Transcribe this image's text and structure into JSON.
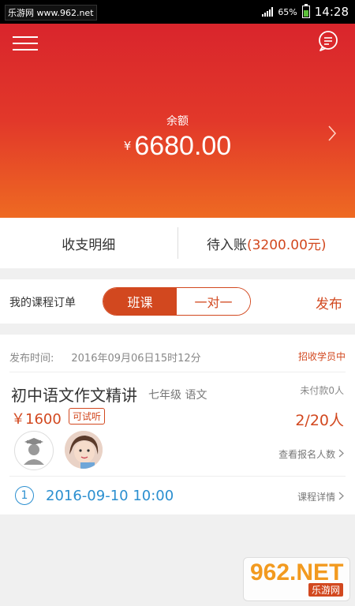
{
  "status_bar": {
    "watermark": "乐游网 www.962.net",
    "battery": "65%",
    "time": "14:28"
  },
  "balance": {
    "label": "余额",
    "currency": "¥",
    "amount": "6680.00"
  },
  "ledger": {
    "income_expense": "收支明细",
    "pending_label": "待入账",
    "pending_amount": "(3200.00元)"
  },
  "orders": {
    "title": "我的课程订单",
    "tabs": [
      {
        "label": "班课",
        "active": true
      },
      {
        "label": "一对一",
        "active": false
      }
    ],
    "publish": "发布"
  },
  "course": {
    "publish_label": "发布时间:",
    "publish_time": "2016年09月06日15时12分",
    "status": "招收学员中",
    "title": "初中语文作文精讲",
    "grade": "七年级",
    "subject": "语文",
    "unpaid": "未付款0人",
    "price": "￥1600",
    "trial": "可试听",
    "enrolled": "2/20人",
    "view_enroll": "查看报名人数",
    "session_number": "1",
    "session_time": "2016-09-10 10:00",
    "detail": "课程详情"
  },
  "watermark_logo": {
    "main": "962.NET",
    "sub": "乐游网"
  },
  "colors": {
    "accent": "#d2481f",
    "hero_top": "#d9252c",
    "hero_bottom": "#ee6a22",
    "link_blue": "#2b8fd0"
  }
}
